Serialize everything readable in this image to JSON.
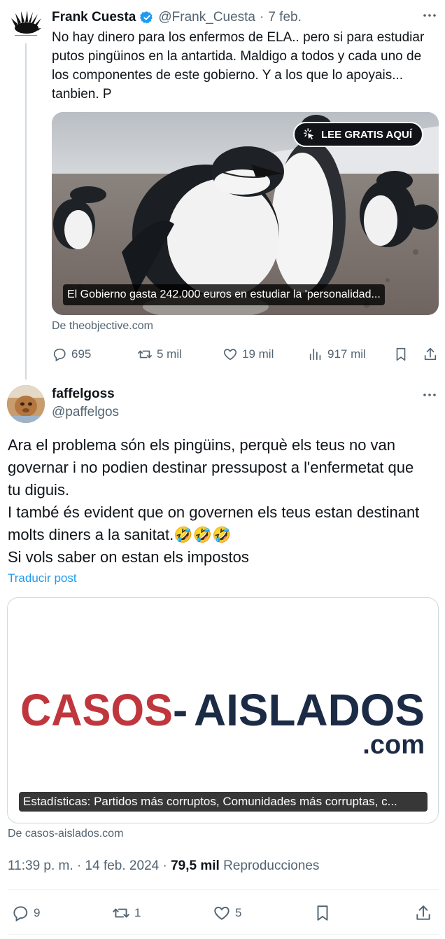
{
  "tweet1": {
    "name": "Frank Cuesta",
    "handle": "@Frank_Cuesta",
    "separator": "·",
    "date": "7 feb.",
    "text": "No hay dinero para los enfermos de ELA.. pero si para estudiar putos pingüinos en la antartida. Maldigo a todos y cada uno de los componentes de este gobierno. Y a los que lo apoyais... tanbien. P",
    "card": {
      "badge": "LEE GRATIS AQUÍ",
      "caption": "El Gobierno gasta 242.000 euros en estudiar la 'personalidad...",
      "source": "De theobjective.com"
    },
    "actions": {
      "replies": "695",
      "reposts": "5 mil",
      "likes": "19 mil",
      "views": "917 mil"
    }
  },
  "tweet2": {
    "name": "faffelgoss",
    "handle": "@paffelgos",
    "text_lines": [
      "Ara el problema són els pingüins, perquè els teus no van",
      "governar i no podien destinar pressupost a l'enfermetat que",
      "tu diguis.",
      "I també és evident que on governen els teus estan destinant",
      "molts diners a la sanitat.🤣🤣🤣",
      "Si vols saber on estan els impostos"
    ],
    "translate": "Traducir post",
    "card": {
      "logo_main": "CASOS",
      "logo_dash": "-",
      "logo_rest": "AISLADOS",
      "logo_suffix": ".com",
      "caption": "Estadísticas: Partidos más corruptos, Comunidades más corruptas, c...",
      "source": "De casos-aislados.com"
    },
    "time": "11:39 p. m.",
    "meta_sep": "·",
    "date": "14 feb. 2024",
    "views": "79,5 mil",
    "views_label": "Reproducciones",
    "actions": {
      "replies": "9",
      "reposts": "1",
      "likes": "5"
    }
  },
  "colors": {
    "text": "#0f1419",
    "muted": "#536471",
    "link": "#1d9bf0",
    "verified": "#1d9bf0",
    "logo_red": "#c0363d",
    "logo_navy": "#1c2b45"
  }
}
